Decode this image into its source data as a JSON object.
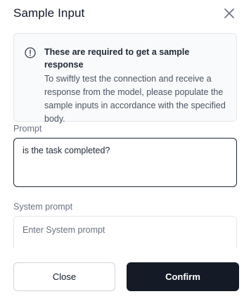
{
  "dialog": {
    "title": "Sample Input",
    "close_icon": "close-icon"
  },
  "info": {
    "icon": "info-icon",
    "heading": "These are required to get a sample response",
    "body": "To swiftly test the connection and receive a response from the model, please populate the sample inputs in accordance with the specified body."
  },
  "fields": {
    "prompt": {
      "label": "Prompt",
      "value": "is the task completed?"
    },
    "system_prompt": {
      "label": "System prompt",
      "placeholder": "Enter System prompt",
      "value": ""
    }
  },
  "footer": {
    "close_label": "Close",
    "confirm_label": "Confirm"
  }
}
